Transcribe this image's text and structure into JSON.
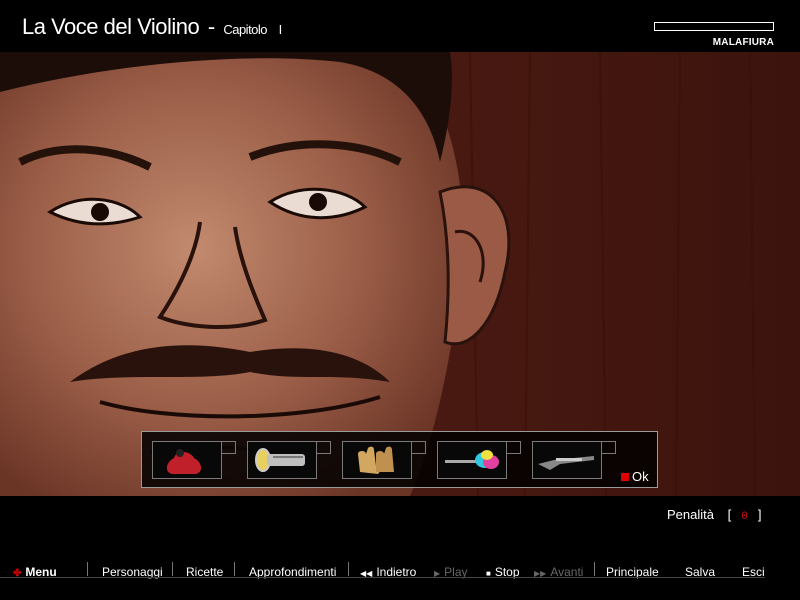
{
  "header": {
    "title_main": "La Voce del Violino",
    "title_sep": "-",
    "title_chapter": "Capitolo",
    "title_chapter_num": "I",
    "brand": "MALAFIURA"
  },
  "inventory": {
    "items": [
      {
        "name": "red-bag-icon"
      },
      {
        "name": "flashlight-icon"
      },
      {
        "name": "gloves-icon"
      },
      {
        "name": "feather-duster-icon"
      },
      {
        "name": "rifle-icon"
      }
    ],
    "ok_label": "Ok"
  },
  "penalty": {
    "label": "Penalità",
    "open_bracket": "[",
    "value": "0",
    "close_bracket": "]"
  },
  "menu": {
    "menu": "Menu",
    "personaggi": "Personaggi",
    "ricette": "Ricette",
    "approfondimenti": "Approfondimenti",
    "indietro": "Indietro",
    "play": "Play",
    "stop": "Stop",
    "avanti": "Avanti",
    "principale": "Principale",
    "salva": "Salva",
    "esci": "Esci"
  },
  "colors": {
    "accent": "#e00000",
    "background": "#000000",
    "wall": "#4a1a12"
  }
}
